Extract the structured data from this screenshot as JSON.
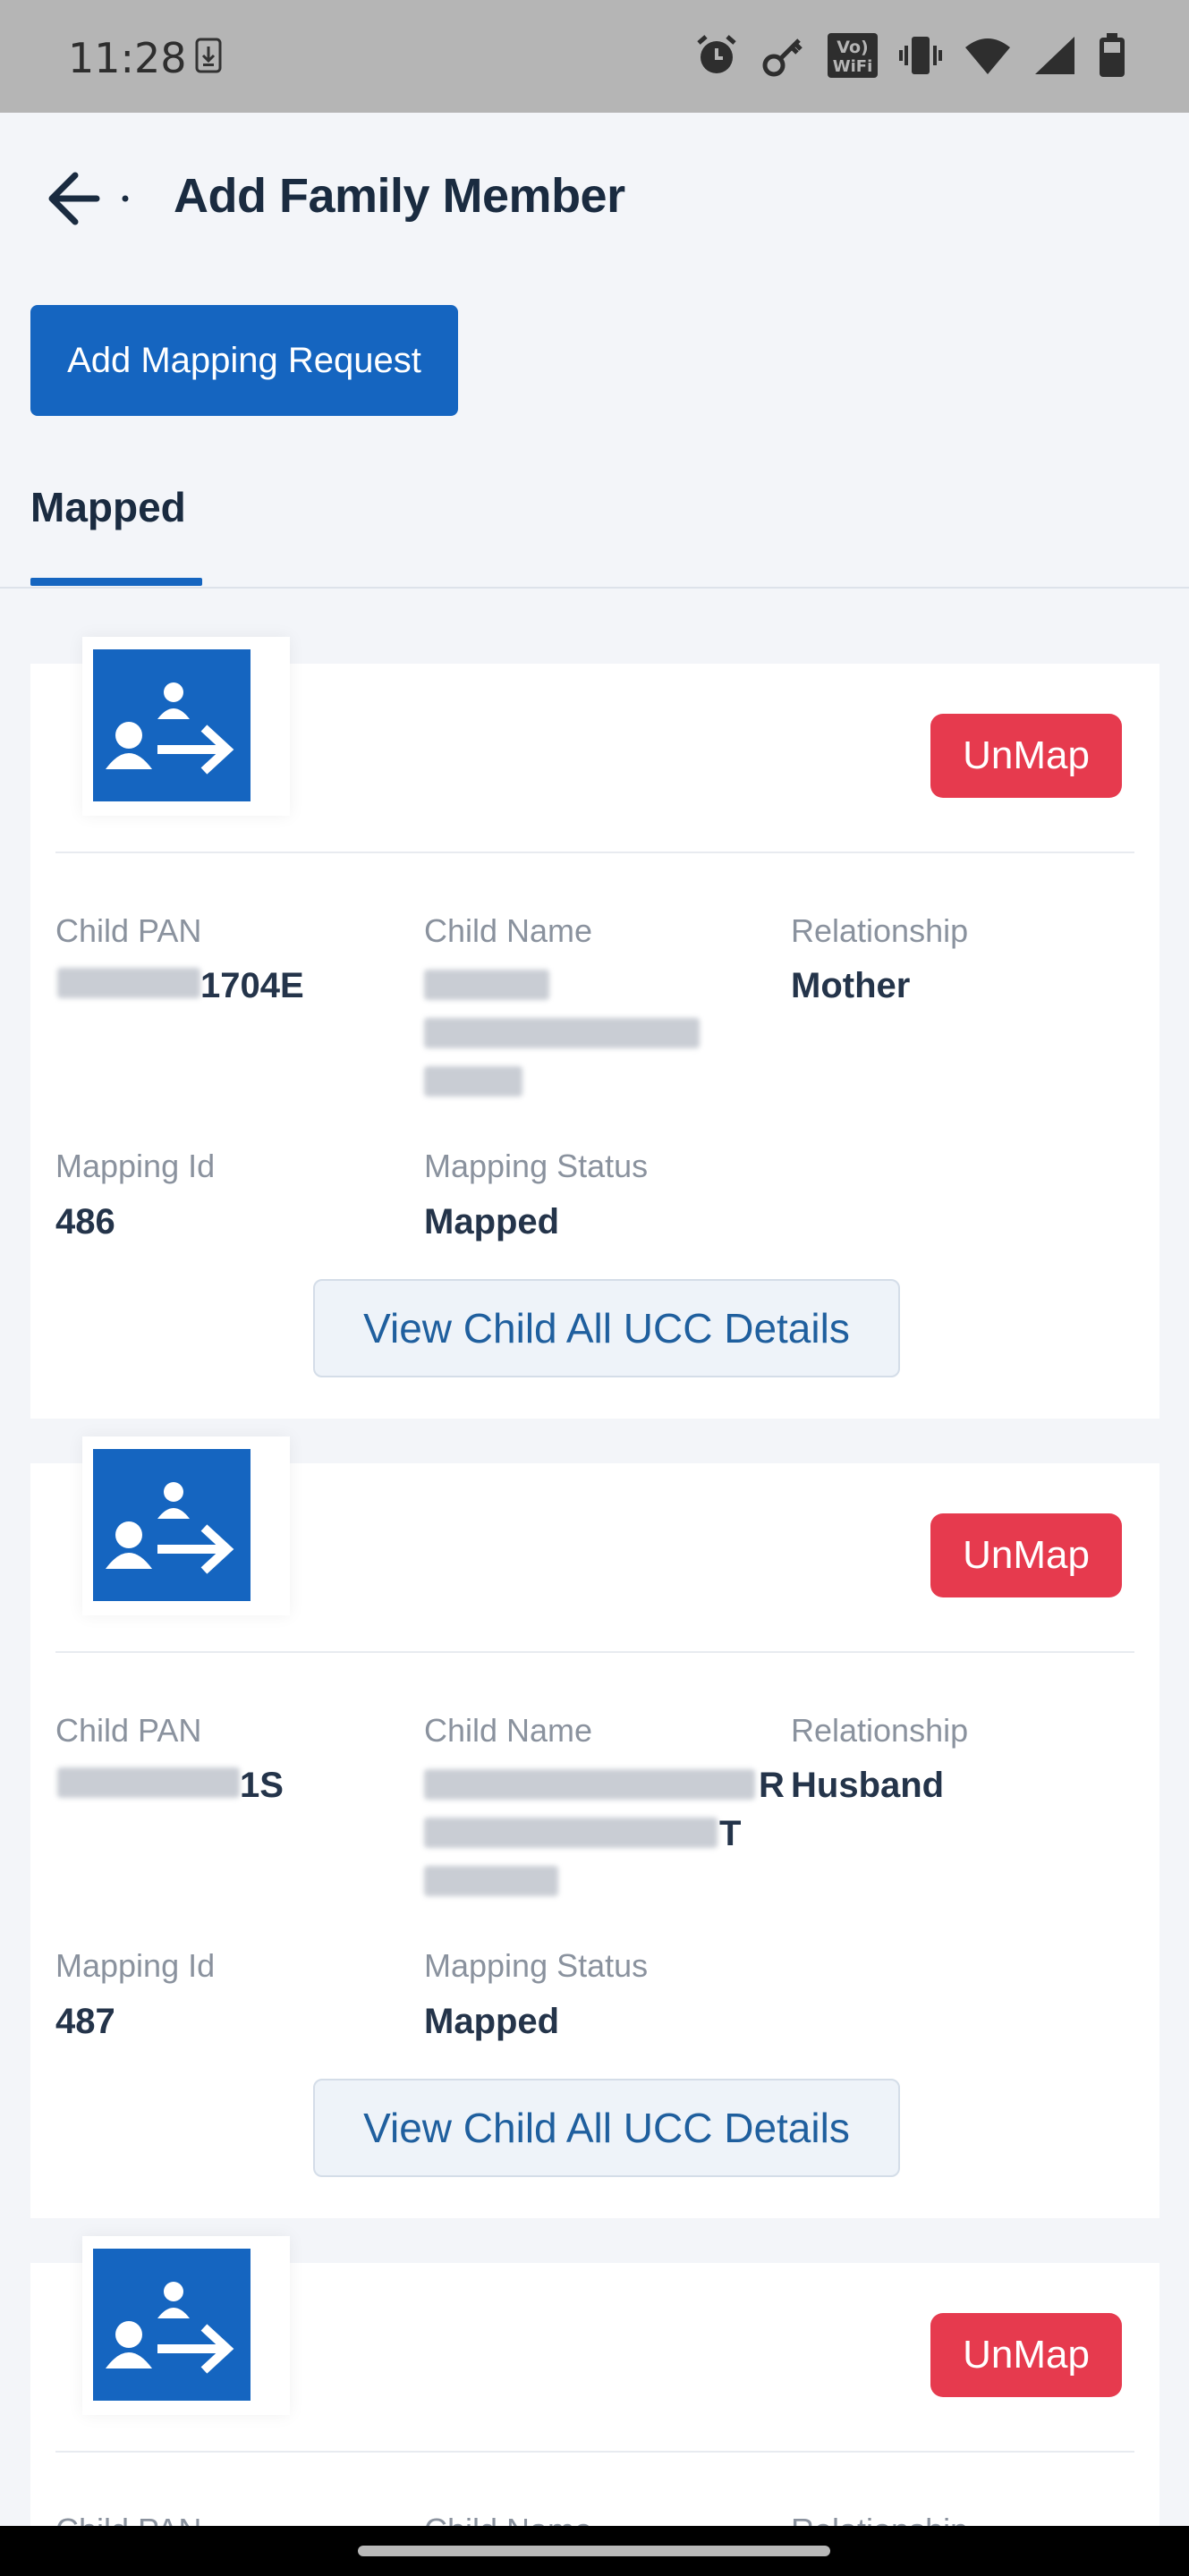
{
  "status_bar": {
    "time": "11:28",
    "icons": [
      "download-icon",
      "alarm-icon",
      "key-icon",
      "volte-wifi-icon",
      "vibrate-icon",
      "wifi-icon",
      "signal-icon",
      "battery-icon"
    ],
    "volte_text_1": "Vo)",
    "volte_text_2": "WiFi"
  },
  "header": {
    "title": "Add Family Member"
  },
  "actions": {
    "add_mapping_label": "Add Mapping Request"
  },
  "tabs": [
    {
      "label": "Mapped",
      "active": true
    }
  ],
  "colors": {
    "primary": "#1565c0",
    "danger": "#e63a4e",
    "background": "#f3f5f9"
  },
  "labels": {
    "child_pan": "Child PAN",
    "child_name": "Child Name",
    "relationship": "Relationship",
    "mapping_id": "Mapping Id",
    "mapping_status": "Mapping Status",
    "unmap": "UnMap",
    "view_details": "View Child All UCC Details"
  },
  "cards": [
    {
      "child_pan_visible": "1704E",
      "relationship": "Mother",
      "mapping_id": "486",
      "mapping_status": "Mapped"
    },
    {
      "child_pan_visible": "1S",
      "child_name_visible_1": "R",
      "child_name_visible_2": "T",
      "relationship": "Husband",
      "mapping_id": "487",
      "mapping_status": "Mapped"
    },
    {
      "partial": true
    }
  ]
}
